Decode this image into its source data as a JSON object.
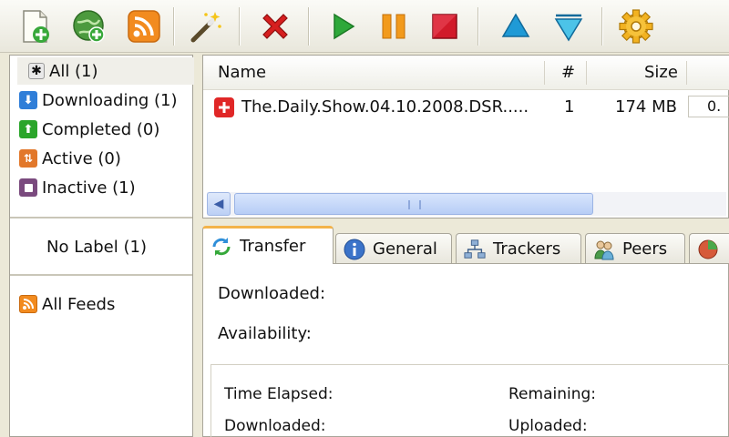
{
  "toolbar": {
    "buttons": [
      {
        "icon": "add-torrent-icon"
      },
      {
        "icon": "add-url-icon"
      },
      {
        "icon": "rss-icon"
      },
      {
        "icon": "magic-wand-icon"
      },
      {
        "icon": "remove-icon"
      },
      {
        "icon": "start-icon"
      },
      {
        "icon": "pause-icon"
      },
      {
        "icon": "stop-icon"
      },
      {
        "icon": "move-up-icon"
      },
      {
        "icon": "move-down-icon"
      },
      {
        "icon": "settings-icon"
      }
    ]
  },
  "sidebar": {
    "categories": [
      {
        "label": "All (1)",
        "color": "#e9e9e9"
      },
      {
        "label": "Downloading (1)",
        "color": "#2f7ed8"
      },
      {
        "label": "Completed (0)",
        "color": "#2aa52a"
      },
      {
        "label": "Active (0)",
        "color": "#e2782b"
      },
      {
        "label": "Inactive (1)",
        "color": "#7a4a7e"
      }
    ],
    "no_label": "No Label (1)",
    "feeds": "All Feeds"
  },
  "list": {
    "columns": [
      "Name",
      "#",
      "Size"
    ],
    "rows": [
      {
        "name": "The.Daily.Show.04.10.2008.DSR.....",
        "num": "1",
        "size": "174 MB",
        "partial": "0."
      }
    ]
  },
  "tabs": [
    {
      "label": "Transfer",
      "icon": "transfer-icon"
    },
    {
      "label": "General",
      "icon": "info-icon"
    },
    {
      "label": "Trackers",
      "icon": "network-icon"
    },
    {
      "label": "Peers",
      "icon": "peers-icon"
    }
  ],
  "transfer": {
    "downloaded": "Downloaded:",
    "availability": "Availability:",
    "time_elapsed": "Time Elapsed:",
    "remaining": "Remaining:",
    "downloaded2": "Downloaded:",
    "uploaded": "Uploaded:"
  },
  "colors": {
    "accent_tab": "#f3b34a",
    "remove_red": "#d61f1f",
    "start_green": "#2ea83a",
    "arrow_blue": "#1f9ad6"
  }
}
